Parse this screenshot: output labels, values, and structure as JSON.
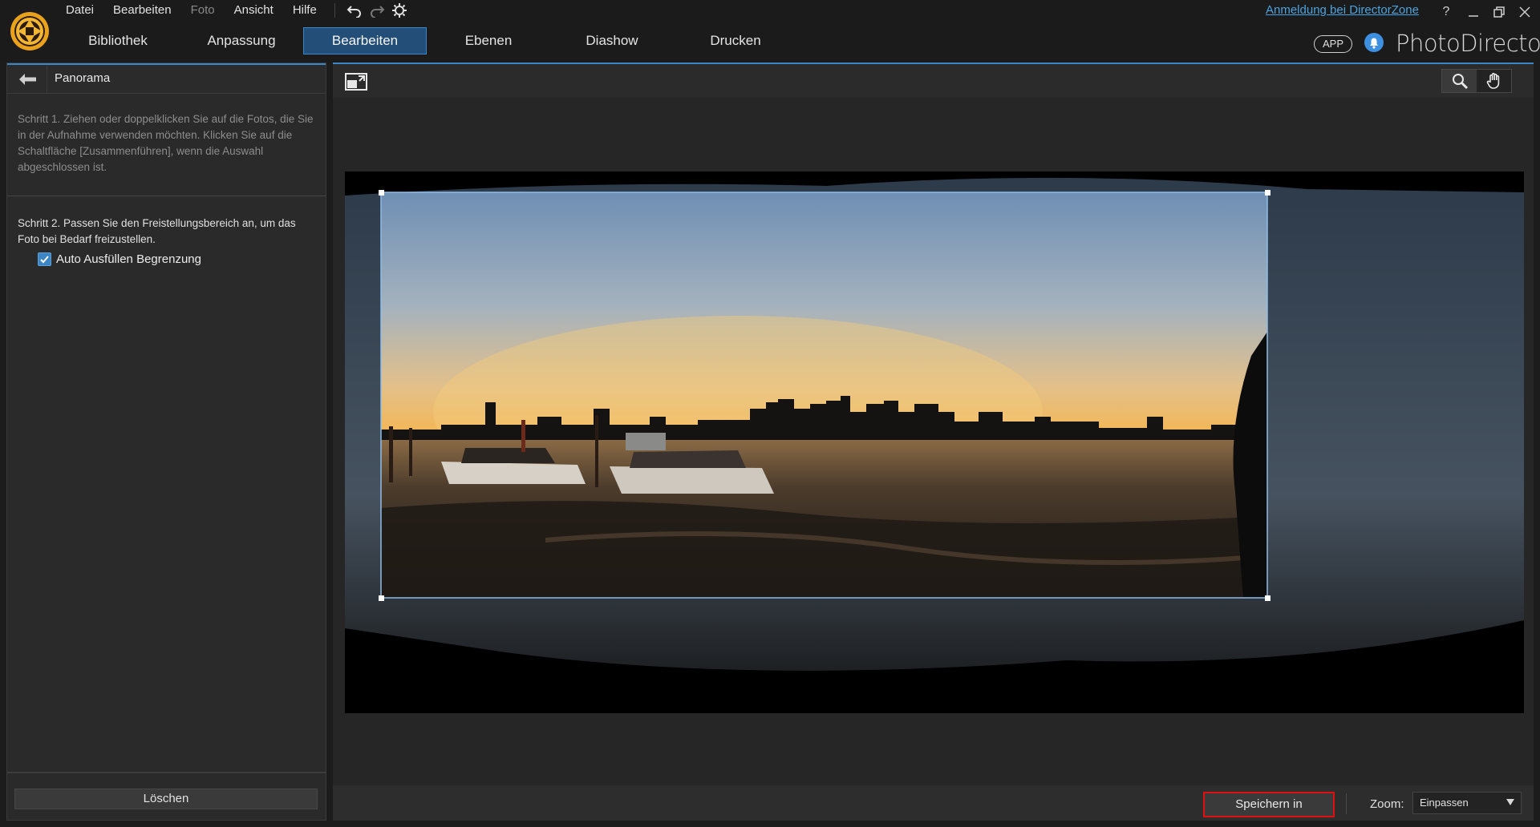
{
  "menu": {
    "items": [
      "Datei",
      "Bearbeiten",
      "Foto",
      "Ansicht",
      "Hilfe"
    ],
    "dimmed_item": "Foto",
    "directorzone_link": "Anmeldung bei DirectorZone",
    "help_label": "?"
  },
  "tabs": [
    {
      "label": "Bibliothek",
      "active": false
    },
    {
      "label": "Anpassung",
      "active": false
    },
    {
      "label": "Bearbeiten",
      "active": true
    },
    {
      "label": "Ebenen",
      "active": false
    },
    {
      "label": "Diashow",
      "active": false
    },
    {
      "label": "Drucken",
      "active": false
    }
  ],
  "brand": {
    "app_badge": "APP",
    "name": "PhotoDirector"
  },
  "left_panel": {
    "title": "Panorama",
    "step1": "Schritt 1. Ziehen oder doppelklicken Sie auf die Fotos, die Sie in der Aufnahme verwenden möchten. Klicken Sie auf die Schaltfläche [Zusammenführen], wenn die Auswahl abgeschlossen ist.",
    "step2": "Schritt 2. Passen Sie den Freistellungsbereich an, um das Foto bei Bedarf freizustellen.",
    "checkbox_label": "Auto Ausfüllen Begrenzung",
    "checkbox_checked": true,
    "delete_button": "Löschen"
  },
  "bottom_bar": {
    "save_button": "Speichern in",
    "zoom_label": "Zoom:",
    "zoom_value": "Einpassen"
  },
  "colors": {
    "accent": "#3d86c6",
    "active_tab_bg": "#234e78",
    "link": "#4aa3e0",
    "highlight_border": "#e01010"
  },
  "icons": [
    "photodirector-logo-icon",
    "undo-icon",
    "redo-icon",
    "settings-gear-icon",
    "minimize-icon",
    "restore-icon",
    "close-icon",
    "bell-icon",
    "back-arrow-icon",
    "fit-view-icon",
    "zoom-magnifier-icon",
    "pan-hand-icon",
    "checkmark-icon",
    "dropdown-caret-icon"
  ]
}
